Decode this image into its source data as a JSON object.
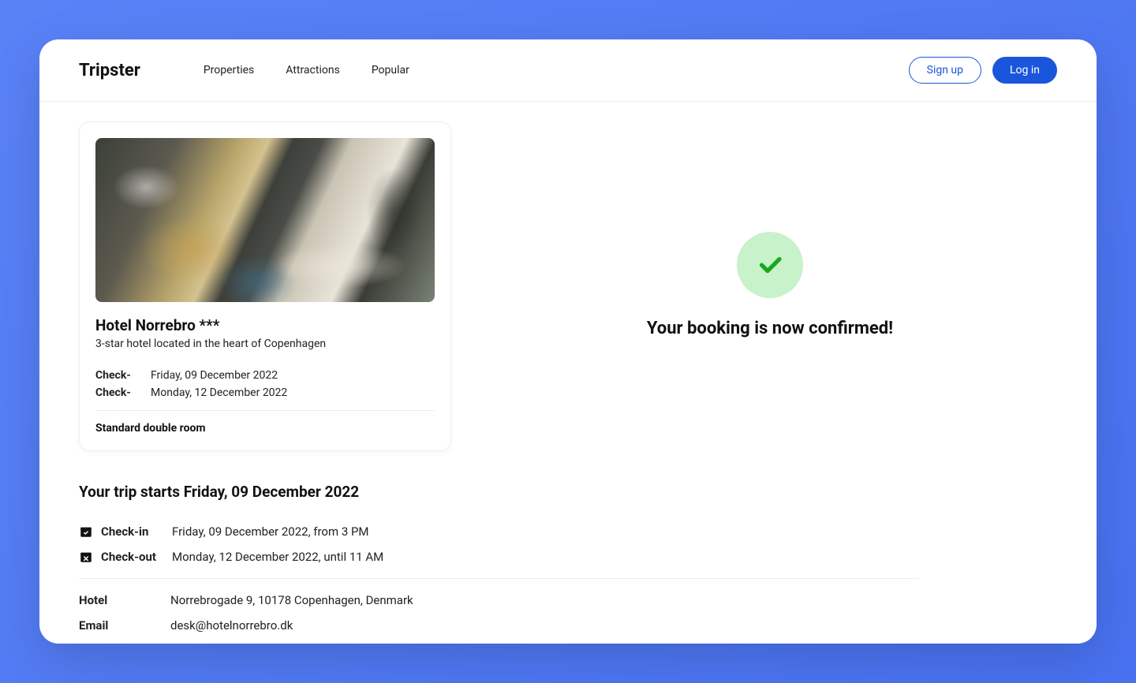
{
  "header": {
    "logo": "Tripster",
    "nav": {
      "properties": "Properties",
      "attractions": "Attractions",
      "popular": "Popular"
    },
    "auth": {
      "signup": "Sign up",
      "login": "Log in"
    }
  },
  "card": {
    "hotel_name": "Hotel Norrebro ***",
    "hotel_desc": "3-star hotel located in the heart of Copenhagen",
    "checkin_label": "Check-",
    "checkin_value": "Friday, 09 December 2022",
    "checkout_label": "Check-",
    "checkout_value": "Monday, 12 December 2022",
    "room_type": "Standard double room"
  },
  "trip": {
    "start_heading": "Your trip starts Friday, 09 December 2022",
    "checkin_label": "Check-in",
    "checkin_value": "Friday, 09 December 2022, from 3 PM",
    "checkout_label": "Check-out",
    "checkout_value": "Monday, 12 December 2022, until 11 AM"
  },
  "contact": {
    "hotel_label": "Hotel",
    "hotel_value": "Norrebrogade 9, 10178 Copenhagen, Denmark",
    "email_label": "Email",
    "email_value": "desk@hotelnorrebro.dk"
  },
  "confirmation": {
    "message": "Your booking is now confirmed!"
  }
}
